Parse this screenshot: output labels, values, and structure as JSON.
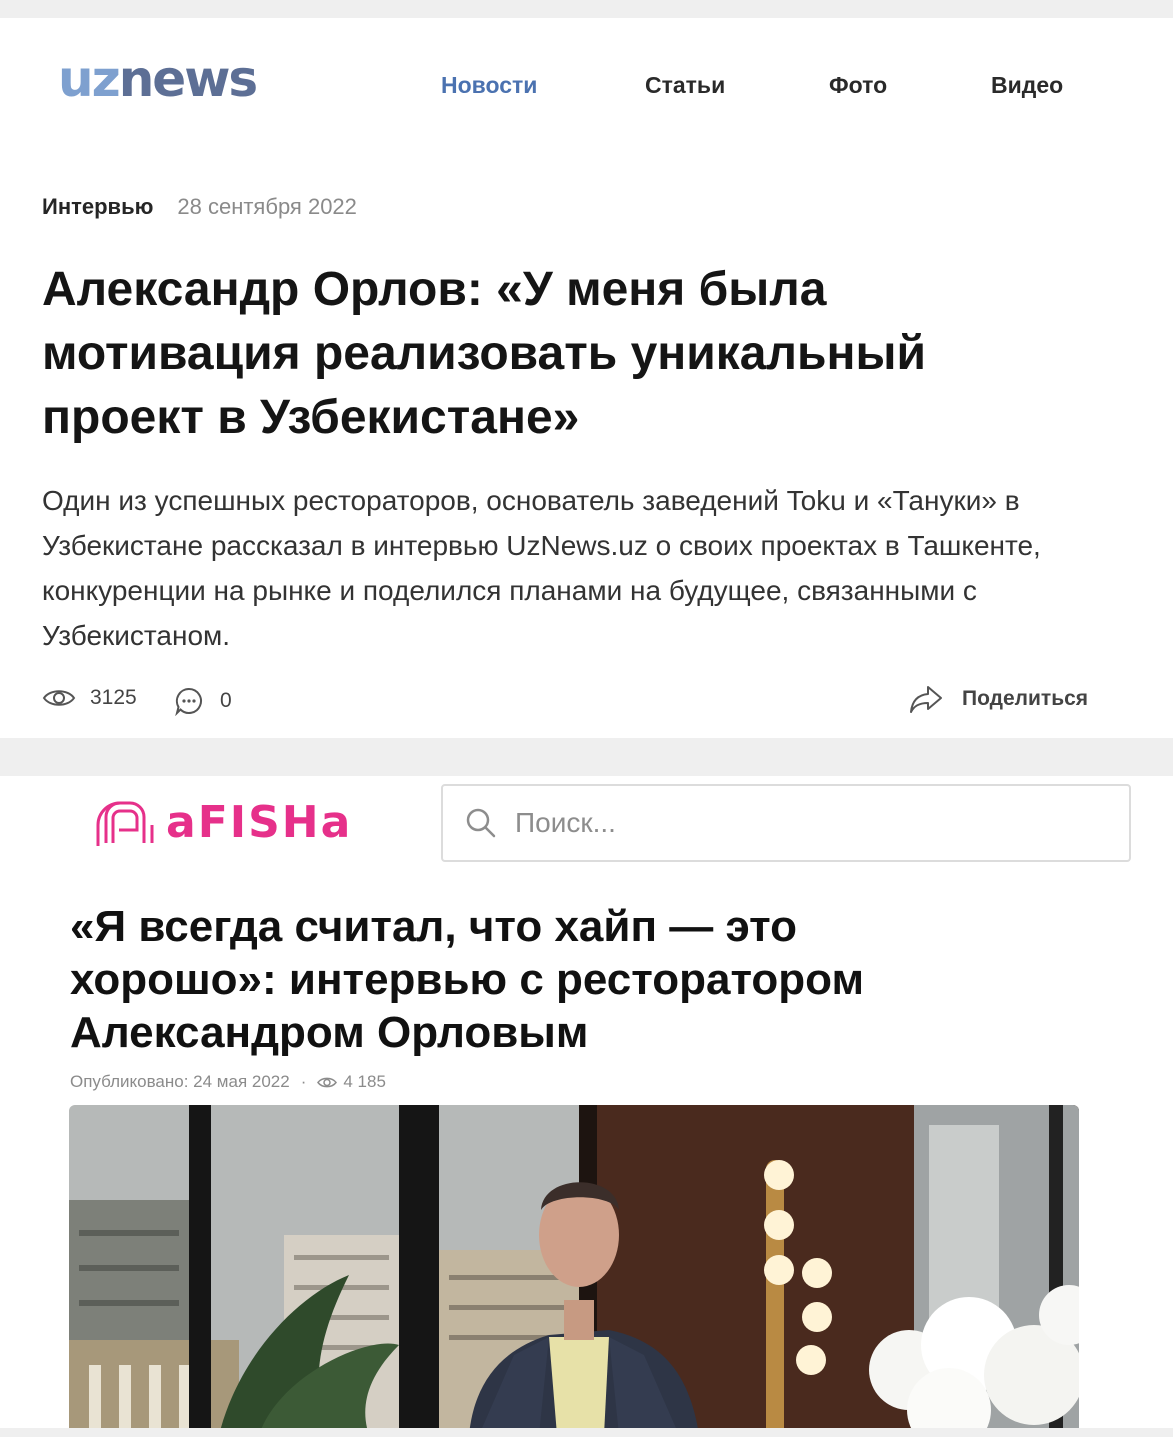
{
  "uznews": {
    "logo": {
      "part1": "uz",
      "part2": "news"
    },
    "nav": [
      {
        "label": "Новости",
        "active": true
      },
      {
        "label": "Статьи",
        "active": false
      },
      {
        "label": "Фото",
        "active": false
      },
      {
        "label": "Видео",
        "active": false
      }
    ],
    "article": {
      "category": "Интервью",
      "date": "28 сентября 2022",
      "title": "Александр Орлов: «У меня была мотивация реализовать уникальный проект в Узбекистане»",
      "lead": "Один из успешных рестораторов, основатель заведений Toku и «Тануки» в Узбекистане рассказал в интервью UzNews.uz о своих проектах в Ташкенте, конкуренции на рынке и поделился планами на будущее, связанными с Узбекистаном.",
      "views": "3125",
      "comments": "0",
      "share_label": "Поделиться"
    },
    "colors": {
      "logo_light": "#7ea0cf",
      "logo_dark": "#5d6f95",
      "nav_active": "#4b72b0"
    }
  },
  "afisha": {
    "logo_text": "aFISHa",
    "search": {
      "placeholder": "Поиск...",
      "value": ""
    },
    "article": {
      "title": "«Я всегда считал, что хайп — это хорошо»: интервью с ресторатором Александром Орловым",
      "published": "Опубликовано: 24 мая 2022",
      "separator": "·",
      "views": "4 185"
    },
    "colors": {
      "brand": "#e6308a"
    }
  },
  "icons": [
    "eye-icon",
    "comment-icon",
    "share-icon",
    "search-icon",
    "afisha-logo-mark"
  ]
}
